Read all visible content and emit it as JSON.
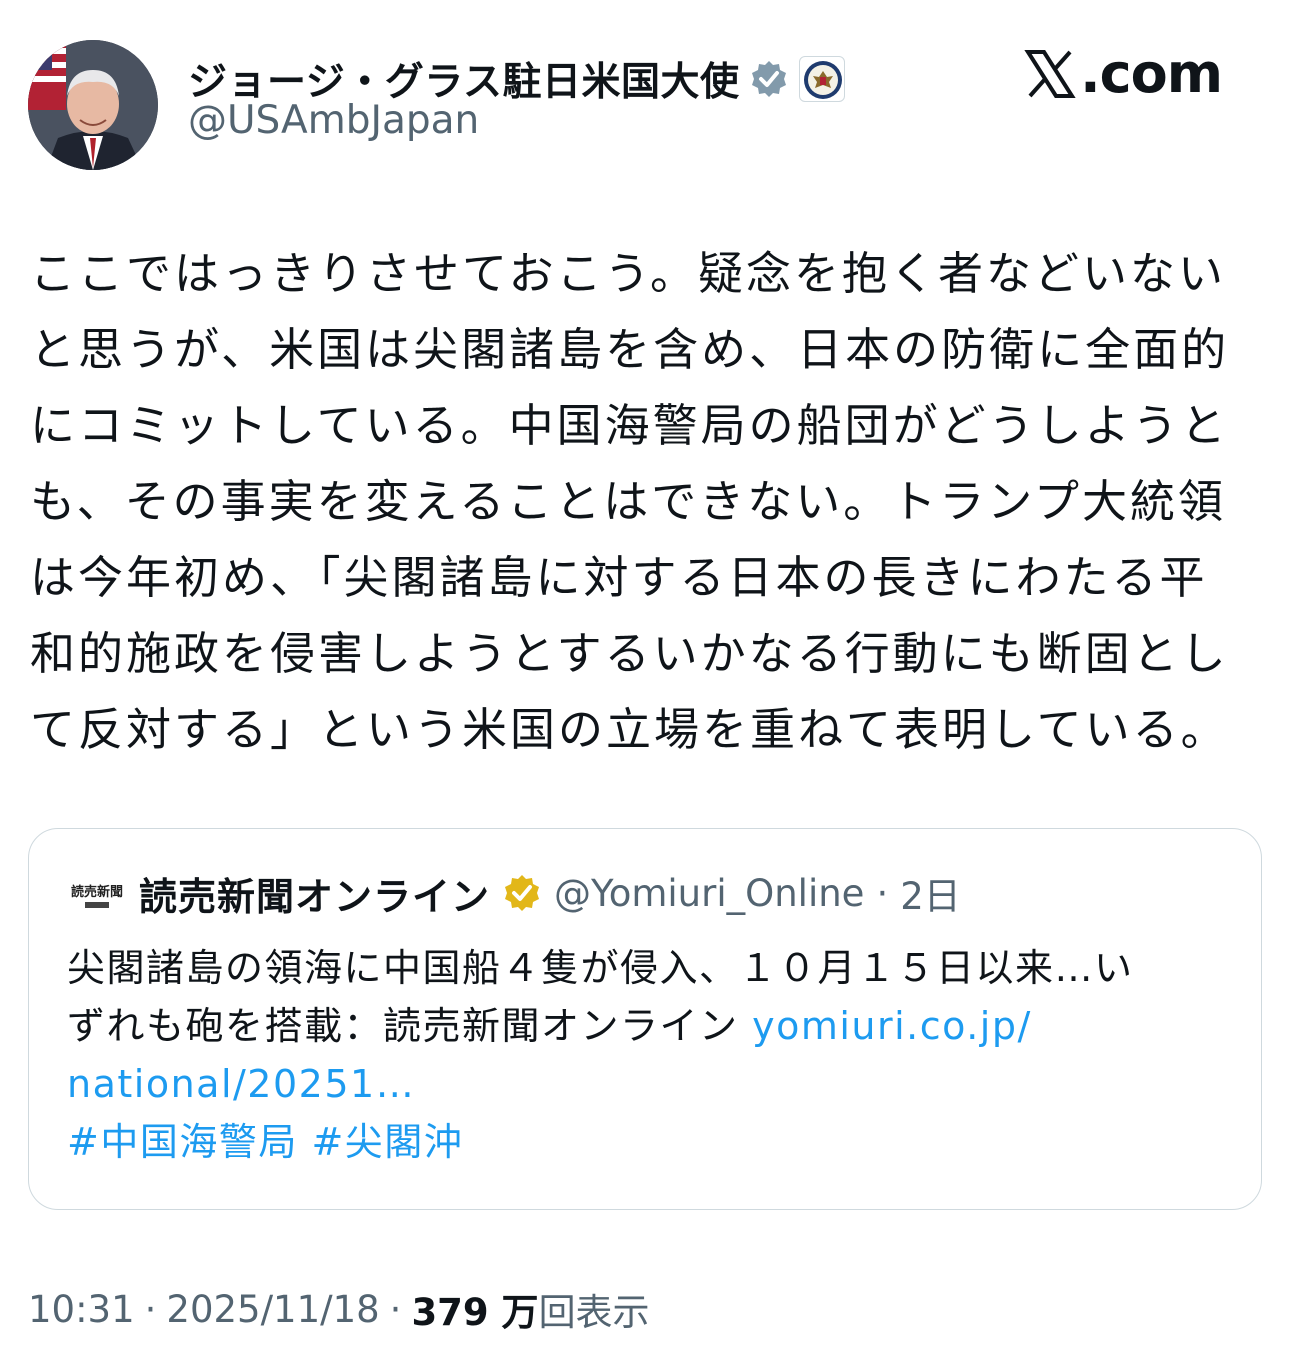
{
  "brand": {
    "site": ".com",
    "x_icon": "x-logo-icon"
  },
  "author": {
    "display_name": "ジョージ・グラス駐日米国大使",
    "handle": "@USAmbJapan",
    "verified_icon": "verified-badge-icon",
    "affiliation_icon": "us-state-dept-seal-icon"
  },
  "tweet": {
    "lines": [
      "ここではっきりさせておこう。疑念を抱く者などいない",
      "と思うが、米国は尖閣諸島を含め、日本の防衛に全面的",
      "にコミットしている。中国海警局の船団がどうしようと",
      "も、その事実を変えることはできない。トランプ大統領",
      "は今年初め、「尖閣諸島に対する日本の長きにわたる平",
      "和的施政を侵害しようとするいかなる行動にも断固とし",
      "て反対する」という米国の立場を重ねて表明している。"
    ]
  },
  "quote": {
    "source_logo_text": "読売新聞",
    "name": "読売新聞オンライン",
    "handle": "@Yomiuri_Online",
    "time": "2日",
    "line1": "尖閣諸島の領海に中国船４隻が侵入、１０月１５日以来…い",
    "line2": "ずれも砲を搭載：読売新聞オンライン ",
    "link_part1": "yomiuri.co.jp/",
    "link_part2": "national/20251…",
    "hashtags": [
      "#中国海警局",
      "#尖閣沖"
    ],
    "gold_badge_icon": "gold-verified-badge-icon"
  },
  "meta": {
    "time": "10:31",
    "date": "2025/11/18",
    "views_num": "379 万",
    "views_label": "回表示",
    "sep": "·"
  },
  "colors": {
    "link": "#1d9bf0",
    "muted": "#536471",
    "text": "#0f1419",
    "border": "#cfd9de"
  }
}
